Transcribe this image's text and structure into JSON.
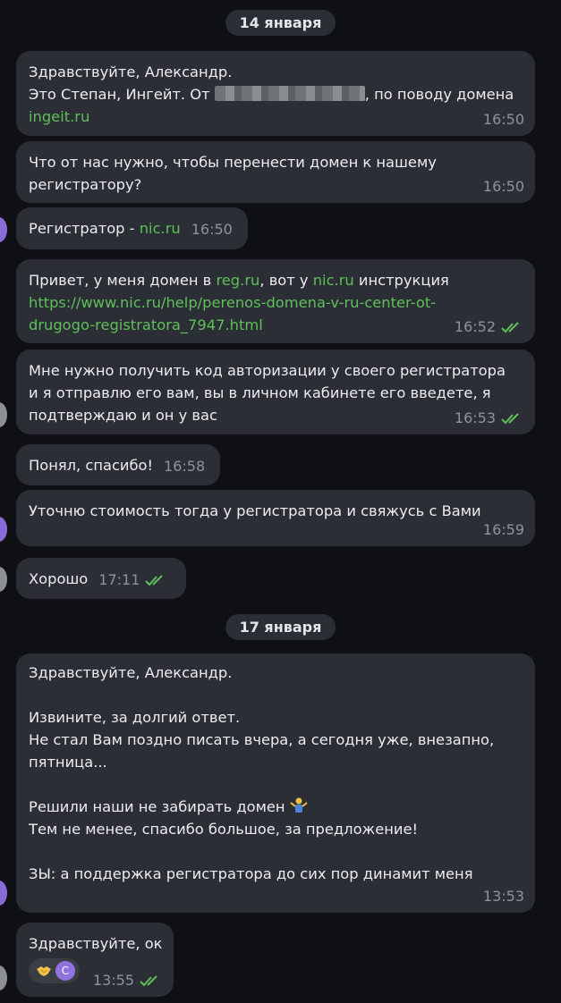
{
  "dates": {
    "first": "14 января",
    "second": "17 января"
  },
  "messages": [
    {
      "line1": "Здравствуйте, Александр.",
      "line2_pre": "Это Степан, Ингейт. От",
      "line2_post": ", по поводу домена",
      "link": "ingeit.ru",
      "time": "16:50"
    },
    {
      "line1": "Что от нас нужно, чтобы перенести домен к нашему",
      "line2": "регистратору?",
      "time": "16:50"
    },
    {
      "text": "Регистратор - ",
      "link": "nic.ru",
      "time": "16:50"
    },
    {
      "pre": "Привет, у меня домен в ",
      "link1": "reg.ru",
      "mid": ", вот у ",
      "link2": "nic.ru",
      "post": " инструкция",
      "url_line1": "https://www.nic.ru/help/perenos-domena-v-ru-center-ot-",
      "url_line2": "drugogo-registratora_7947.html",
      "time": "16:52"
    },
    {
      "line1": "Мне нужно получить код авторизации у своего регистратора",
      "line2": "и я отправлю его вам, вы в личном кабинете его введете, я",
      "line3": "подтверждаю и он у вас",
      "time": "16:53"
    },
    {
      "text": "Понял, спасибо!",
      "time": "16:58"
    },
    {
      "text": "Уточню стоимость тогда у регистратора и свяжусь с Вами",
      "time": "16:59"
    },
    {
      "text": "Хорошо",
      "time": "17:11"
    },
    {
      "l1": "Здравствуйте, Александр.",
      "l2": "Извините, за долгий ответ.",
      "l3": "Не стал Вам поздно писать вчера, а сегодня уже, внезапно,",
      "l4": "пятница...",
      "l5": "Решили наши не забирать домен",
      "l6": "Тем не менее, спасибо большое, за предложение!",
      "l7": "ЗЫ: а поддержка регистратора до сих пор динамит меня",
      "time": "13:53"
    },
    {
      "text": "Здравствуйте, ок",
      "reaction_avatar_letter": "С",
      "time": "13:55"
    }
  ],
  "colors": {
    "background": "#0e1014",
    "bubble": "#2b2f35",
    "link": "#5fbf5a",
    "read_ticks": "#5fbf5a"
  }
}
